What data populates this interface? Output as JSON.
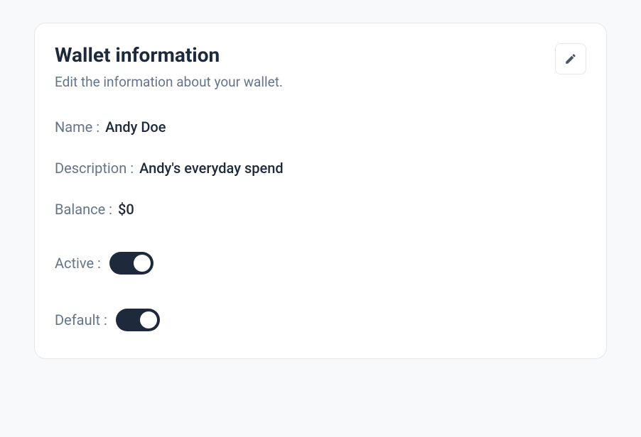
{
  "card": {
    "title": "Wallet information",
    "subtitle": "Edit the information about your wallet."
  },
  "fields": {
    "name": {
      "label": "Name :",
      "value": "Andy Doe"
    },
    "description": {
      "label": "Description :",
      "value": "Andy's everyday spend"
    },
    "balance": {
      "label": "Balance :",
      "value": "$0"
    },
    "active": {
      "label": "Active :",
      "state": true
    },
    "default": {
      "label": "Default :",
      "state": true
    }
  },
  "icons": {
    "edit": "pencil-icon"
  }
}
